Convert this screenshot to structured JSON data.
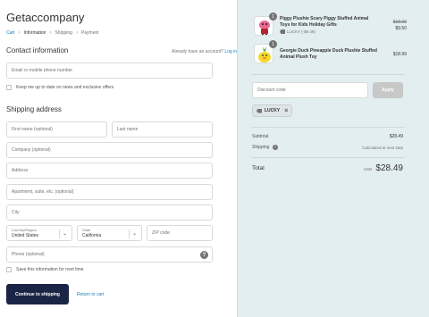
{
  "store": {
    "name": "Getaccompany"
  },
  "breadcrumb": [
    {
      "label": "Cart"
    },
    {
      "label": "Information"
    },
    {
      "label": "Shipping"
    },
    {
      "label": "Payment"
    }
  ],
  "contact": {
    "title": "Contact information",
    "login_prompt": "Already have an account?",
    "login_link": "Log in",
    "email_placeholder": "Email or mobile phone number",
    "newsletter_label": "Keep me up to date on news and exclusive offers"
  },
  "shipping": {
    "title": "Shipping address",
    "first_name_placeholder": "First name (optional)",
    "last_name_placeholder": "Last name",
    "company_placeholder": "Company (optional)",
    "address_placeholder": "Address",
    "apartment_placeholder": "Apartment, suite, etc. (optional)",
    "city_placeholder": "City",
    "country_label": "Country/Region",
    "country_value": "United States",
    "state_label": "State",
    "state_value": "California",
    "zip_placeholder": "ZIP code",
    "phone_placeholder": "Phone (optional)",
    "save_info_label": "Save this information for next time"
  },
  "actions": {
    "continue_label": "Continue to shipping",
    "return_label": "Return to cart"
  },
  "order": {
    "items": [
      {
        "quantity": "1",
        "title": "Piggy Plushie Scary Piggy Stuffed Animal Toys for Kids Holiday Gifts",
        "discount": "LUCKY (-$9.49)",
        "original_price": "$18.99",
        "price": "$9.50"
      },
      {
        "quantity": "1",
        "title": "Georgie Duck Pineapple Duck Plushie Stuffed Animal Plush Toy",
        "price": "$18.99"
      }
    ],
    "discount_placeholder": "Discount code",
    "apply_label": "Apply",
    "applied_code": "LUCKY",
    "subtotal_label": "Subtotal",
    "subtotal_value": "$28.49",
    "shipping_label": "Shipping",
    "shipping_value": "Calculated at next step",
    "total_label": "Total",
    "currency": "USD",
    "total_value": "$28.49"
  },
  "colors": {
    "link": "#197bbd",
    "primary_button": "#1a2444",
    "sidebar_bg": "#e3eef0"
  }
}
